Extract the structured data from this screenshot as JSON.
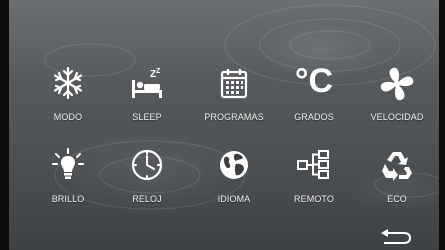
{
  "menu": {
    "items": [
      {
        "label": "MODO",
        "icon": "snowflake-icon"
      },
      {
        "label": "SLEEP",
        "icon": "sleep-bed-icon"
      },
      {
        "label": "PROGRAMAS",
        "icon": "calendar-icon"
      },
      {
        "label": "GRADOS",
        "icon": "celsius-icon",
        "symbol": "°C"
      },
      {
        "label": "VELOCIDAD",
        "icon": "fan-icon"
      },
      {
        "label": "BRILLO",
        "icon": "bulb-icon"
      },
      {
        "label": "RELOJ",
        "icon": "clock-icon"
      },
      {
        "label": "IDIOMA",
        "icon": "globe-icon"
      },
      {
        "label": "REMOTO",
        "icon": "network-tree-icon"
      },
      {
        "label": "ECO",
        "icon": "recycle-icon"
      }
    ]
  },
  "sleep_glyph": "Z",
  "back": {
    "icon": "back-arrow-icon"
  }
}
